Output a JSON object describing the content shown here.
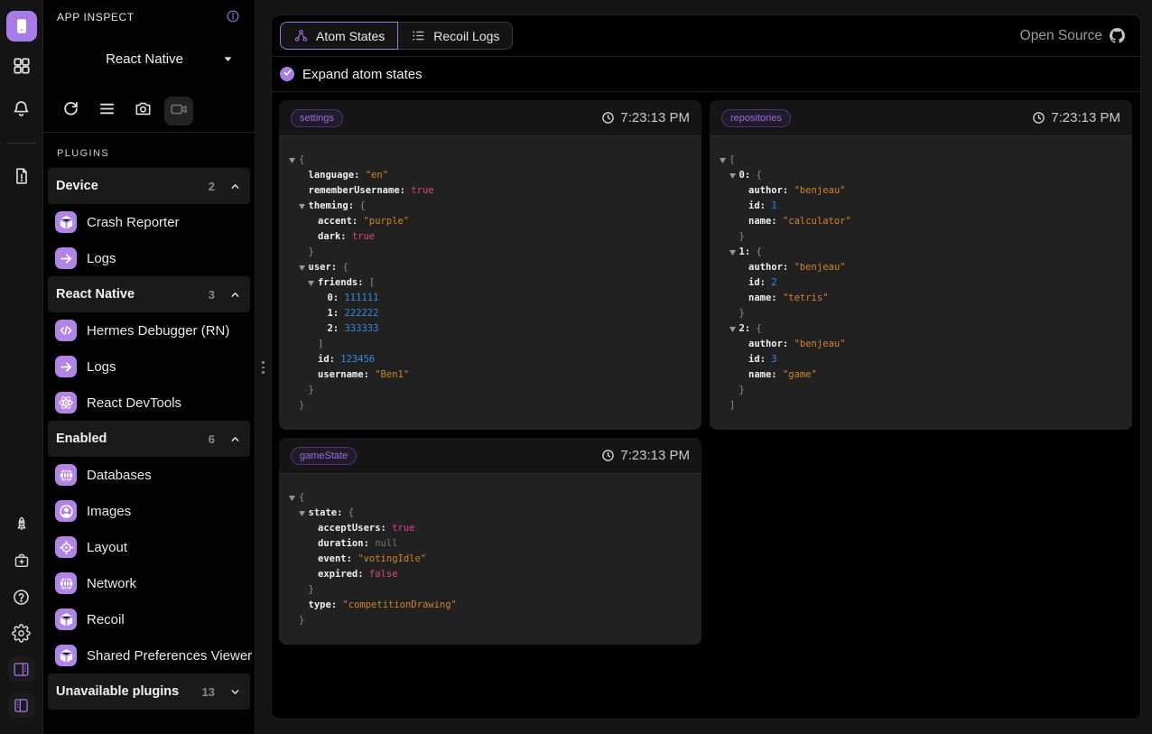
{
  "colors": {
    "accent_purple": "#9d6fe0",
    "icon_purple": "#b284e6",
    "string": "#d2822c",
    "number": "#338ae6",
    "boolean": "#dd4488",
    "null": "#757575"
  },
  "rail": {
    "top": [
      {
        "icon": "phone-app",
        "name": "active-app",
        "active": true
      },
      {
        "icon": "grid",
        "name": "apps"
      },
      {
        "icon": "bell",
        "name": "notifications"
      },
      {
        "icon": "divider",
        "name": "divider"
      },
      {
        "icon": "file-alert",
        "name": "logs-report"
      }
    ],
    "bottom": [
      {
        "icon": "rocket",
        "name": "getting-started"
      },
      {
        "icon": "toolbox",
        "name": "toolbox"
      },
      {
        "icon": "help-circle",
        "name": "help"
      },
      {
        "icon": "gear",
        "name": "settings"
      },
      {
        "icon": "panel-right",
        "name": "toggle-right-panel",
        "boxed": true
      },
      {
        "icon": "panel-left",
        "name": "toggle-left-panel",
        "boxed": true
      }
    ]
  },
  "sidebar": {
    "title": "APP INSPECT",
    "device_selector": {
      "value": "React Native"
    },
    "toolbar": [
      {
        "icon": "reload",
        "name": "reload"
      },
      {
        "icon": "menu",
        "name": "menu"
      },
      {
        "icon": "camera",
        "name": "screenshot"
      },
      {
        "icon": "video",
        "name": "screen-record",
        "active_bg": true
      }
    ],
    "plugins_label": "PLUGINS",
    "groups": [
      {
        "label": "Device",
        "count": "2",
        "state": "expanded",
        "items": [
          {
            "icon": "cube",
            "label": "Crash Reporter"
          },
          {
            "icon": "arrow-right",
            "label": "Logs"
          }
        ]
      },
      {
        "label": "React Native",
        "count": "3",
        "state": "expanded",
        "items": [
          {
            "icon": "code",
            "label": "Hermes Debugger (RN)"
          },
          {
            "icon": "arrow-right",
            "label": "Logs"
          },
          {
            "icon": "react",
            "label": "React DevTools"
          }
        ]
      },
      {
        "label": "Enabled",
        "count": "6",
        "state": "expanded",
        "items": [
          {
            "icon": "globe",
            "label": "Databases"
          },
          {
            "icon": "user-circle",
            "label": "Images"
          },
          {
            "icon": "target",
            "label": "Layout"
          },
          {
            "icon": "globe",
            "label": "Network"
          },
          {
            "icon": "cube",
            "label": "Recoil"
          },
          {
            "icon": "cube",
            "label": "Shared Preferences Viewer"
          }
        ]
      },
      {
        "label": "Unavailable plugins",
        "count": "13",
        "state": "collapsed",
        "items": []
      }
    ]
  },
  "main": {
    "tabs": [
      {
        "label": "Atom States",
        "icon": "molecule",
        "selected": true
      },
      {
        "label": "Recoil Logs",
        "icon": "list",
        "selected": false
      }
    ],
    "open_source": {
      "label": "Open Source",
      "icon": "github"
    },
    "expand_checkbox": {
      "label": "Expand atom states",
      "checked": true
    },
    "atoms": [
      {
        "name": "settings",
        "timestamp": "7:23:13 PM",
        "value": {
          "language": "en",
          "rememberUsername": true,
          "theming": {
            "accent": "purple",
            "dark": true
          },
          "user": {
            "friends": [
              111111,
              222222,
              333333
            ],
            "id": 123456,
            "username": "Ben1"
          }
        }
      },
      {
        "name": "repositories",
        "timestamp": "7:23:13 PM",
        "value": [
          {
            "author": "benjeau",
            "id": 1,
            "name": "calculator"
          },
          {
            "author": "benjeau",
            "id": 2,
            "name": "tetris"
          },
          {
            "author": "benjeau",
            "id": 3,
            "name": "game"
          }
        ]
      },
      {
        "name": "gameState",
        "timestamp": "7:23:13 PM",
        "value": {
          "state": {
            "acceptUsers": true,
            "duration": null,
            "event": "votingIdle",
            "expired": false
          },
          "type": "competitionDrawing"
        }
      }
    ]
  }
}
